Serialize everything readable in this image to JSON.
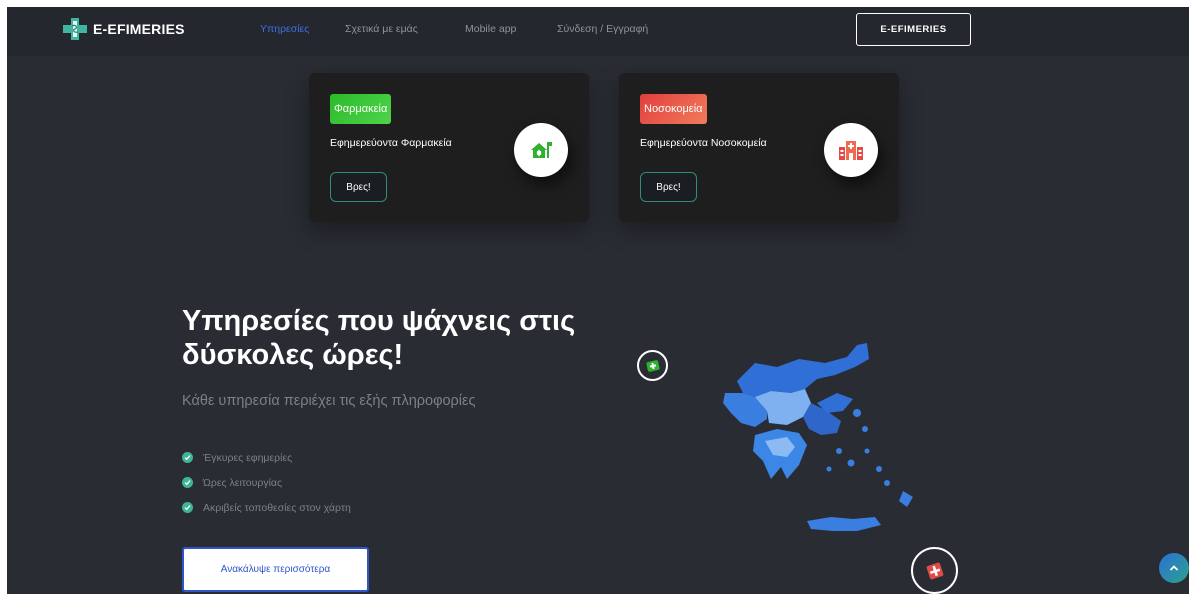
{
  "brand": {
    "name": "E-EFIMERIES"
  },
  "nav": {
    "links": [
      "Υπηρεσίες",
      "Σχετικά με εμάς",
      "Mobile app",
      "Σύνδεση / Εγγραφή"
    ],
    "cta": "E-EFIMERIES"
  },
  "cards": [
    {
      "badge": "Φαρμακεία",
      "title": "Εφημερεύοντα Φαρμακεία",
      "button": "Βρες!",
      "icon": "pharmacy-house-icon"
    },
    {
      "badge": "Νοσοκομεία",
      "title": "Εφημερεύοντα Νοσοκομεία",
      "button": "Βρες!",
      "icon": "hospital-building-icon"
    }
  ],
  "hero": {
    "title_line1": "Υπηρεσίες που ψάχνεις στις",
    "title_line2": "δύσκολες ώρες!",
    "subtitle": "Κάθε υπηρεσία περιέχει τις εξής πληροφορίες",
    "features": [
      "Έγκυρες εφημερίες",
      "Ώρες λειτουργίας",
      "Ακριβείς τοποθεσίες στον χάρτη"
    ],
    "cta": "Ανακάλυψε περισσότερα"
  },
  "colors": {
    "background": "#292c33",
    "navbar": "#24272d",
    "accent_blue": "#3f6fe0",
    "pharmacy_green": "#2bbb2b",
    "hospital_red": "#e23e3e",
    "check_teal": "#3fb598"
  }
}
